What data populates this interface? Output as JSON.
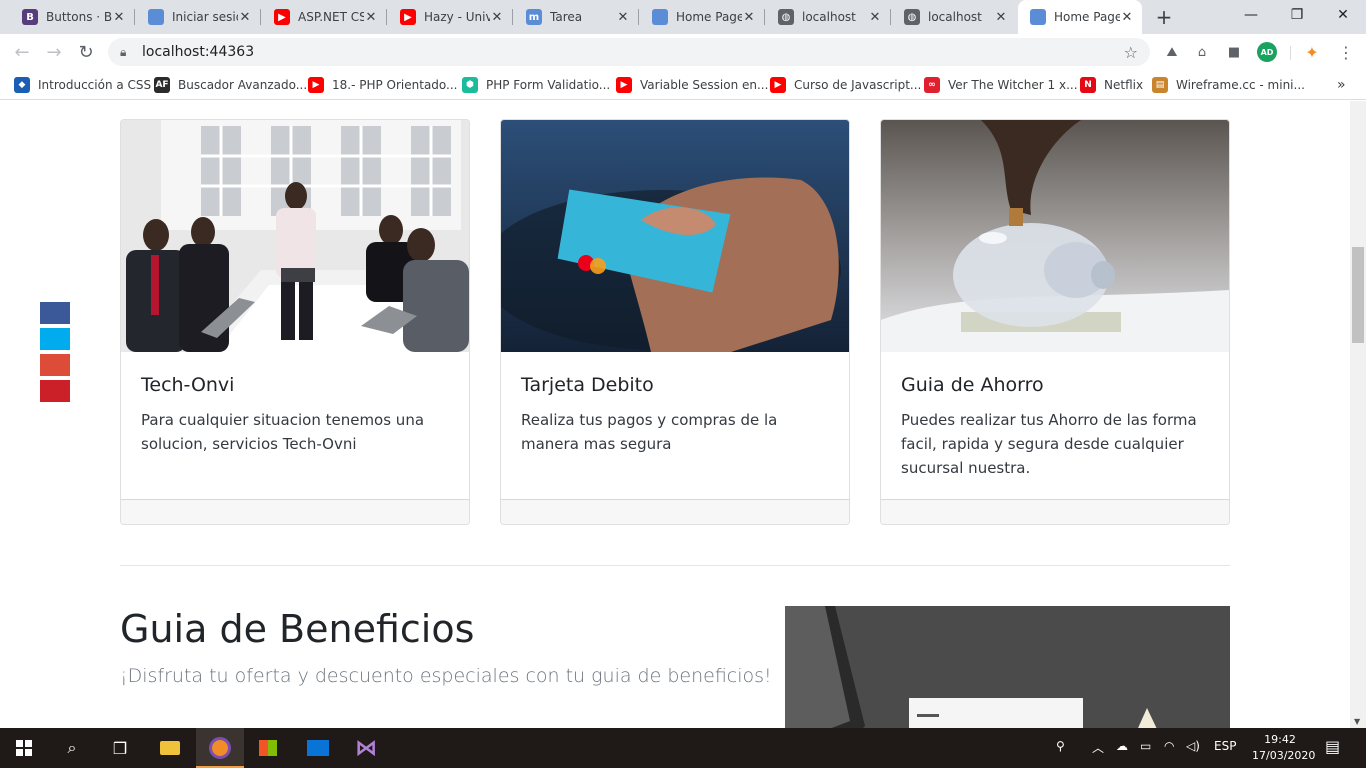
{
  "browser": {
    "tabs": [
      {
        "title": "Buttons · Bo",
        "favicon": "bootstrap-icon",
        "color": "#563d7c",
        "glyph": "B"
      },
      {
        "title": "Iniciar sesió",
        "favicon": "page-icon",
        "color": "#5b8dd6",
        "glyph": ""
      },
      {
        "title": "ASP.NET CS",
        "favicon": "youtube-icon",
        "color": "#ff0000",
        "glyph": "▶"
      },
      {
        "title": "Hazy - Univ",
        "favicon": "youtube-icon",
        "color": "#ff0000",
        "glyph": "▶"
      },
      {
        "title": "Tarea",
        "favicon": "moodle-icon",
        "color": "#5b8dd6",
        "glyph": "m"
      },
      {
        "title": "Home Page",
        "favicon": "page-icon",
        "color": "#5b8dd6",
        "glyph": ""
      },
      {
        "title": "localhost",
        "favicon": "globe-icon",
        "color": "#5f6368",
        "glyph": "◍"
      },
      {
        "title": "localhost",
        "favicon": "globe-icon",
        "color": "#5f6368",
        "glyph": "◍"
      },
      {
        "title": "Home Page",
        "favicon": "page-icon",
        "color": "#5b8dd6",
        "glyph": ""
      }
    ],
    "active_tab_index": 8,
    "url": "localhost:44363",
    "bookmarks": [
      {
        "label": "Introducción a CSS",
        "icon": "diamond-icon",
        "color": "#1a5fb4",
        "glyph": "◆"
      },
      {
        "label": "Buscador Avanzado...",
        "icon": "af-icon",
        "color": "#2b2b2b",
        "glyph": "AF"
      },
      {
        "label": "18.- PHP Orientado...",
        "icon": "youtube-icon",
        "color": "#ff0000",
        "glyph": "▶"
      },
      {
        "label": "PHP Form Validatio...",
        "icon": "shield-icon",
        "color": "#1abc9c",
        "glyph": "⬢"
      },
      {
        "label": "Variable Session en...",
        "icon": "youtube-icon",
        "color": "#ff0000",
        "glyph": "▶"
      },
      {
        "label": "Curso de Javascript...",
        "icon": "youtube-icon",
        "color": "#ff0000",
        "glyph": "▶"
      },
      {
        "label": "Ver The Witcher 1 x...",
        "icon": "infinity-icon",
        "color": "#e0202e",
        "glyph": "∞"
      },
      {
        "label": "Netflix",
        "icon": "netflix-icon",
        "color": "#e50914",
        "glyph": "N"
      },
      {
        "label": "Wireframe.cc - mini...",
        "icon": "wireframe-icon",
        "color": "#c9852e",
        "glyph": "▤"
      }
    ],
    "profile_initials": "AD"
  },
  "social": [
    {
      "name": "facebook",
      "color": "#3b5998"
    },
    {
      "name": "twitter",
      "color": "#00aced"
    },
    {
      "name": "google-plus",
      "color": "#dd4b39"
    },
    {
      "name": "pinterest",
      "color": "#cb2027"
    }
  ],
  "cards": [
    {
      "title": "Tech-Onvi",
      "text": "Para cualquier situacion tenemos una solucion, servicios Tech-Ovni",
      "image": "office-meeting-photo"
    },
    {
      "title": "Tarjeta Debito",
      "text": "Realiza tus pagos y compras de la manera mas segura",
      "image": "debit-card-photo"
    },
    {
      "title": "Guia de Ahorro",
      "text": "Puedes realizar tus Ahorro de las forma facil, rapida y segura desde cualquier sucursal nuestra.",
      "image": "piggy-bank-photo"
    }
  ],
  "benefits": {
    "heading": "Guia de Beneficios",
    "lead": "¡Disfruta tu oferta y descuento especiales con tu guia de beneficios!",
    "image": "laptop-desk-photo"
  },
  "taskbar": {
    "language": "ESP",
    "time": "19:42",
    "date": "17/03/2020"
  }
}
